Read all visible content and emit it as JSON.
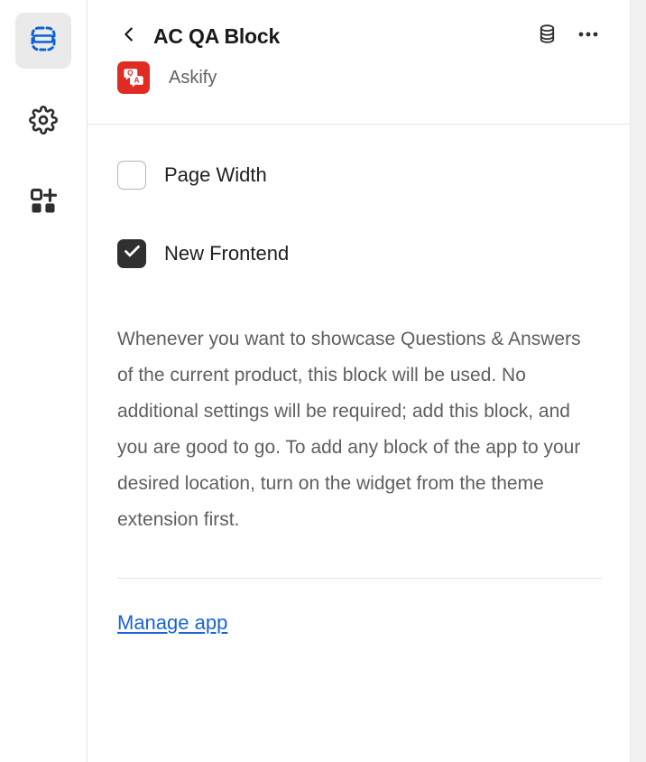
{
  "rail": {
    "items": [
      {
        "name": "sections-icon",
        "label": "Sections",
        "active": true
      },
      {
        "name": "settings-icon",
        "label": "Settings",
        "active": false
      },
      {
        "name": "add-blocks-icon",
        "label": "Add blocks",
        "active": false
      }
    ]
  },
  "header": {
    "back_label": "Back",
    "title": "AC QA Block",
    "app_name": "Askify",
    "app_icon_letters": {
      "q": "Q",
      "a": "A"
    },
    "app_icon_color": "#e02c22",
    "actions": [
      {
        "name": "database-icon",
        "label": "Metafields"
      },
      {
        "name": "more-menu-icon",
        "label": "More actions"
      }
    ]
  },
  "settings": {
    "checkboxes": [
      {
        "label": "Page Width",
        "checked": false
      },
      {
        "label": "New Frontend",
        "checked": true
      }
    ],
    "description": "Whenever you want to showcase Questions & Answers of the current product, this block will be used. No additional settings will be required; add this block, and you are good to go. To add any block of the app to your desired location, turn on the widget from the theme extension first.",
    "manage_link": "Manage app"
  },
  "colors": {
    "accent_blue": "#1a63d8",
    "rail_active_blue": "#0d62d4",
    "checkbox_on": "#303030",
    "text_primary": "#1a1a1a",
    "text_secondary": "#5c5f62"
  }
}
